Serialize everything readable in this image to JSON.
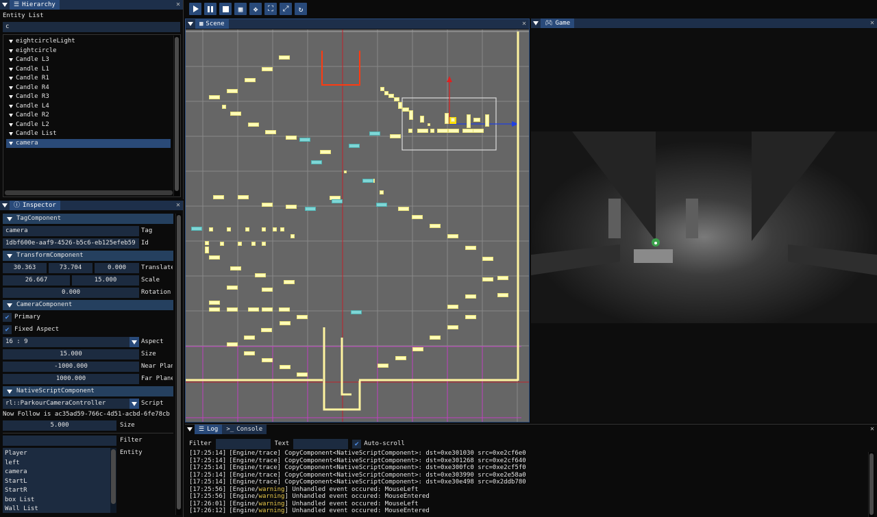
{
  "toolbar": {
    "buttons": [
      "play-icon",
      "pause-icon",
      "stop-icon",
      "grid-icon",
      "move-icon",
      "expand-icon",
      "fullscreen-icon",
      "refresh-icon"
    ]
  },
  "hierarchy": {
    "title": "Hierarchy",
    "entity_list_label": "Entity List",
    "search_value": "c",
    "items": [
      "eightcircleLight",
      "eightcircle",
      "Candle L3",
      "Candle L1",
      "Candle R1",
      "Candle R4",
      "Candle R3",
      "Candle L4",
      "Candle R2",
      "Candle L2",
      "Candle List",
      "camera"
    ],
    "selected": "camera"
  },
  "inspector": {
    "title": "Inspector",
    "tag_component": "TagComponent",
    "tag_value": "camera",
    "tag_label": "Tag",
    "id_value": "1dbf600e-aaf9-4526-b5c6-eb125efeb59",
    "id_label": "Id",
    "transform_component": "TransformComponent",
    "translate": [
      "30.363",
      "73.704",
      "0.000"
    ],
    "translate_label": "Translate",
    "scale": [
      "26.667",
      "15.000"
    ],
    "scale_label": "Scale",
    "rotation": "0.000",
    "rotation_label": "Rotation",
    "camera_component": "CameraComponent",
    "primary_label": "Primary",
    "fixed_aspect_label": "Fixed Aspect",
    "aspect_value": "16 : 9",
    "aspect_label": "Aspect",
    "size_value": "15.000",
    "size_label": "Size",
    "near_value": "-1000.000",
    "near_label": "Near Plane",
    "far_value": "1000.000",
    "far_label": "Far Plane",
    "native_component": "NativeScriptComponent",
    "script_value": "rl::ParkourCameraController",
    "script_label": "Script",
    "follow_text": "Now Follow is ac35ad59-766c-4d51-acbd-6fe78cb",
    "follow_size": "5.000",
    "follow_size_label": "Size",
    "filter_label": "Filter",
    "entity_label": "Entity",
    "entities": [
      "Player",
      "left",
      "camera",
      "StartL",
      "StartR",
      "box List",
      "Wall List"
    ]
  },
  "scene": {
    "title": "Scene"
  },
  "game": {
    "title": "Game"
  },
  "log": {
    "tab_log": "Log",
    "tab_console": "Console",
    "filter_label": "Filter",
    "text_label": "Text",
    "autoscroll_label": "Auto-scroll",
    "lines": [
      {
        "time": "[17:25:14]",
        "src": "[Engine/",
        "lvl": "trace",
        "msg": "] CopyComponent<NativeScriptComponent>: dst=0xe301030 src=0xe2cf6e0"
      },
      {
        "time": "[17:25:14]",
        "src": "[Engine/",
        "lvl": "trace",
        "msg": "] CopyComponent<NativeScriptComponent>: dst=0xe301268 src=0xe2cf640"
      },
      {
        "time": "[17:25:14]",
        "src": "[Engine/",
        "lvl": "trace",
        "msg": "] CopyComponent<NativeScriptComponent>: dst=0xe300fc0 src=0xe2cf5f0"
      },
      {
        "time": "[17:25:14]",
        "src": "[Engine/",
        "lvl": "trace",
        "msg": "] CopyComponent<NativeScriptComponent>: dst=0xe303990 src=0xe2e58a0"
      },
      {
        "time": "[17:25:14]",
        "src": "[Engine/",
        "lvl": "trace",
        "msg": "] CopyComponent<NativeScriptComponent>: dst=0xe30e498 src=0x2ddb780"
      },
      {
        "time": "[17:25:56]",
        "src": "[Engine/",
        "lvl": "warning",
        "msg": "] Unhandled event occured: MouseLeft"
      },
      {
        "time": "[17:25:56]",
        "src": "[Engine/",
        "lvl": "warning",
        "msg": "] Unhandled event occured: MouseEntered"
      },
      {
        "time": "[17:26:01]",
        "src": "[Engine/",
        "lvl": "warning",
        "msg": "] Unhandled event occured: MouseLeft"
      },
      {
        "time": "[17:26:12]",
        "src": "[Engine/",
        "lvl": "warning",
        "msg": "] Unhandled event occured: MouseEntered"
      }
    ]
  }
}
